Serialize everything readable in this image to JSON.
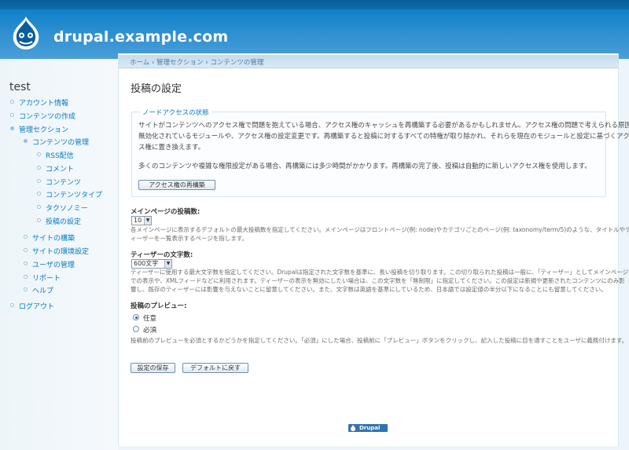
{
  "site": {
    "name": "drupal.example.com"
  },
  "sidebar": {
    "user": "test",
    "items": [
      {
        "label": "アカウント情報",
        "level": 0
      },
      {
        "label": "コンテンツの作成",
        "level": 0
      },
      {
        "label": "管理セクション",
        "level": 0
      },
      {
        "label": "コンテンツの管理",
        "level": 1
      },
      {
        "label": "RSS配信",
        "level": 2
      },
      {
        "label": "コメント",
        "level": 2
      },
      {
        "label": "コンテンツ",
        "level": 2
      },
      {
        "label": "コンテンツタイプ",
        "level": 2
      },
      {
        "label": "タクソノミー",
        "level": 2
      },
      {
        "label": "投稿の設定",
        "level": 2
      },
      {
        "label": "サイトの構築",
        "level": 1
      },
      {
        "label": "サイトの環境設定",
        "level": 1
      },
      {
        "label": "ユーザの管理",
        "level": 1
      },
      {
        "label": "リポート",
        "level": 1
      },
      {
        "label": "ヘルプ",
        "level": 1
      },
      {
        "label": "ログアウト",
        "level": 0
      }
    ]
  },
  "breadcrumb": "ホーム › 管理セクション › コンテンツの管理",
  "page": {
    "title": "投稿の設定"
  },
  "node_access": {
    "legend": "ノードアクセスの状態",
    "para1_line1": "サイトがコンテンツへのアクセス権で問題を抱えている場合、アクセス権のキャッシュを再構築する必要があるかもしれません。アクセス権の問題で考えられる原因は、",
    "para1_line2": "無効化されているモジュールや、アクセス権の設定変更です。再構築すると投稿に対するすべての特権が取り除かれ、それらを現在のモジュールと設定に基づくアクセ",
    "para1_line3": "ス権に置き換えます。",
    "para2": "多くのコンテンツや複雑な権限設定がある場合、再構築には多少時間がかかります。再構築の完了後、投稿は自動的に新しいアクセス権を使用します。",
    "rebuild_button": "アクセス権の再構築"
  },
  "posts_per_page": {
    "label": "メインページの投稿数:",
    "value": "10",
    "desc_line1": "各メインページに表示するデフォルトの最大投稿数を指定してください。メインページはフロントページ(例: node)やカテゴリごとのページ(例: taxonomy/term/5)のような、タイトルやテ",
    "desc_line2": "ィーザーを一覧表示するページを指します。"
  },
  "teaser_length": {
    "label": "ティーザーの文字数:",
    "value": "600文字",
    "desc_line1": "ティーザーに使用する最大文字数を指定してください。Drupalは指定された文字数を基準に、長い投稿を切り取ります。この切り取られた投稿は一般に、「ティーザー」としてメインページ",
    "desc_line2": "での表示や、XMLフィードなどに利用されます。ティーザーの表示を無効にしたい場合は、この文字数を「無制限」に指定してください。この設定は新規や更新されたコンテンツにのみ影",
    "desc_line3": "響し、既存のティーザーには影響を与えないことに留意してください。また、文字数は英語を基準にしているため、日本語では設定値の半分以下になることにも留意してください。"
  },
  "preview": {
    "label": "投稿のプレビュー:",
    "options": [
      "任意",
      "必須"
    ],
    "selected": "任意",
    "desc": "投稿前のプレビューを必須とするかどうかを指定してください。「必須」にした場合、投稿前に「プレビュー」ボタンをクリックし、記入した投稿に目を通すことをユーザに義務付けます。"
  },
  "actions": {
    "save": "設定の保存",
    "reset": "デフォルトに戻す"
  },
  "footer": {
    "badge": "Drupal"
  },
  "colors": {
    "header": "#027ac6",
    "link": "#027ac6"
  }
}
